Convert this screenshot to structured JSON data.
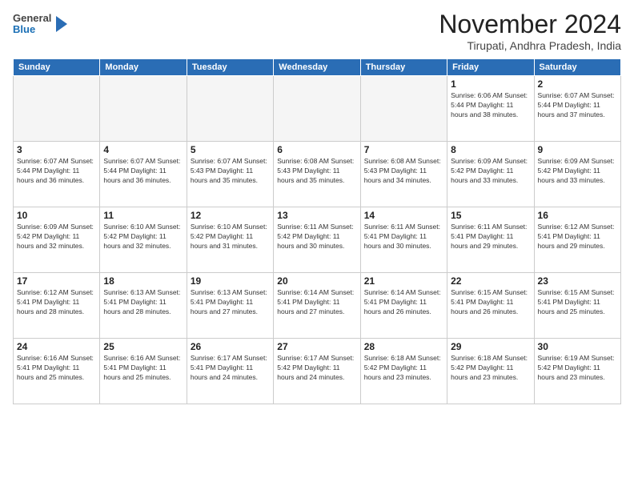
{
  "header": {
    "logo_line1": "General",
    "logo_line2": "Blue",
    "month_title": "November 2024",
    "subtitle": "Tirupati, Andhra Pradesh, India"
  },
  "weekdays": [
    "Sunday",
    "Monday",
    "Tuesday",
    "Wednesday",
    "Thursday",
    "Friday",
    "Saturday"
  ],
  "weeks": [
    [
      {
        "day": "",
        "info": ""
      },
      {
        "day": "",
        "info": ""
      },
      {
        "day": "",
        "info": ""
      },
      {
        "day": "",
        "info": ""
      },
      {
        "day": "",
        "info": ""
      },
      {
        "day": "1",
        "info": "Sunrise: 6:06 AM\nSunset: 5:44 PM\nDaylight: 11 hours and 38 minutes."
      },
      {
        "day": "2",
        "info": "Sunrise: 6:07 AM\nSunset: 5:44 PM\nDaylight: 11 hours and 37 minutes."
      }
    ],
    [
      {
        "day": "3",
        "info": "Sunrise: 6:07 AM\nSunset: 5:44 PM\nDaylight: 11 hours and 36 minutes."
      },
      {
        "day": "4",
        "info": "Sunrise: 6:07 AM\nSunset: 5:44 PM\nDaylight: 11 hours and 36 minutes."
      },
      {
        "day": "5",
        "info": "Sunrise: 6:07 AM\nSunset: 5:43 PM\nDaylight: 11 hours and 35 minutes."
      },
      {
        "day": "6",
        "info": "Sunrise: 6:08 AM\nSunset: 5:43 PM\nDaylight: 11 hours and 35 minutes."
      },
      {
        "day": "7",
        "info": "Sunrise: 6:08 AM\nSunset: 5:43 PM\nDaylight: 11 hours and 34 minutes."
      },
      {
        "day": "8",
        "info": "Sunrise: 6:09 AM\nSunset: 5:42 PM\nDaylight: 11 hours and 33 minutes."
      },
      {
        "day": "9",
        "info": "Sunrise: 6:09 AM\nSunset: 5:42 PM\nDaylight: 11 hours and 33 minutes."
      }
    ],
    [
      {
        "day": "10",
        "info": "Sunrise: 6:09 AM\nSunset: 5:42 PM\nDaylight: 11 hours and 32 minutes."
      },
      {
        "day": "11",
        "info": "Sunrise: 6:10 AM\nSunset: 5:42 PM\nDaylight: 11 hours and 32 minutes."
      },
      {
        "day": "12",
        "info": "Sunrise: 6:10 AM\nSunset: 5:42 PM\nDaylight: 11 hours and 31 minutes."
      },
      {
        "day": "13",
        "info": "Sunrise: 6:11 AM\nSunset: 5:42 PM\nDaylight: 11 hours and 30 minutes."
      },
      {
        "day": "14",
        "info": "Sunrise: 6:11 AM\nSunset: 5:41 PM\nDaylight: 11 hours and 30 minutes."
      },
      {
        "day": "15",
        "info": "Sunrise: 6:11 AM\nSunset: 5:41 PM\nDaylight: 11 hours and 29 minutes."
      },
      {
        "day": "16",
        "info": "Sunrise: 6:12 AM\nSunset: 5:41 PM\nDaylight: 11 hours and 29 minutes."
      }
    ],
    [
      {
        "day": "17",
        "info": "Sunrise: 6:12 AM\nSunset: 5:41 PM\nDaylight: 11 hours and 28 minutes."
      },
      {
        "day": "18",
        "info": "Sunrise: 6:13 AM\nSunset: 5:41 PM\nDaylight: 11 hours and 28 minutes."
      },
      {
        "day": "19",
        "info": "Sunrise: 6:13 AM\nSunset: 5:41 PM\nDaylight: 11 hours and 27 minutes."
      },
      {
        "day": "20",
        "info": "Sunrise: 6:14 AM\nSunset: 5:41 PM\nDaylight: 11 hours and 27 minutes."
      },
      {
        "day": "21",
        "info": "Sunrise: 6:14 AM\nSunset: 5:41 PM\nDaylight: 11 hours and 26 minutes."
      },
      {
        "day": "22",
        "info": "Sunrise: 6:15 AM\nSunset: 5:41 PM\nDaylight: 11 hours and 26 minutes."
      },
      {
        "day": "23",
        "info": "Sunrise: 6:15 AM\nSunset: 5:41 PM\nDaylight: 11 hours and 25 minutes."
      }
    ],
    [
      {
        "day": "24",
        "info": "Sunrise: 6:16 AM\nSunset: 5:41 PM\nDaylight: 11 hours and 25 minutes."
      },
      {
        "day": "25",
        "info": "Sunrise: 6:16 AM\nSunset: 5:41 PM\nDaylight: 11 hours and 25 minutes."
      },
      {
        "day": "26",
        "info": "Sunrise: 6:17 AM\nSunset: 5:41 PM\nDaylight: 11 hours and 24 minutes."
      },
      {
        "day": "27",
        "info": "Sunrise: 6:17 AM\nSunset: 5:42 PM\nDaylight: 11 hours and 24 minutes."
      },
      {
        "day": "28",
        "info": "Sunrise: 6:18 AM\nSunset: 5:42 PM\nDaylight: 11 hours and 23 minutes."
      },
      {
        "day": "29",
        "info": "Sunrise: 6:18 AM\nSunset: 5:42 PM\nDaylight: 11 hours and 23 minutes."
      },
      {
        "day": "30",
        "info": "Sunrise: 6:19 AM\nSunset: 5:42 PM\nDaylight: 11 hours and 23 minutes."
      }
    ]
  ]
}
